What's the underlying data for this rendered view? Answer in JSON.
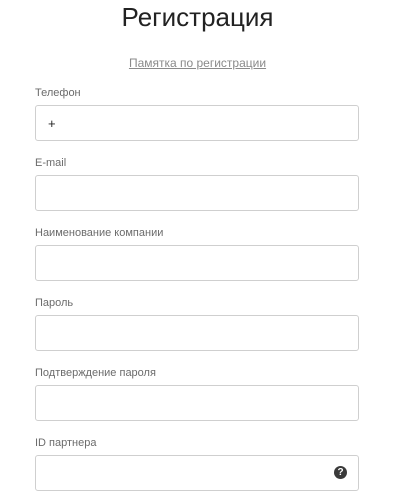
{
  "page": {
    "title": "Регистрация",
    "memo_link": "Памятка по регистрации"
  },
  "fields": {
    "phone": {
      "label": "Телефон",
      "value": "+"
    },
    "email": {
      "label": "E-mail",
      "value": ""
    },
    "company": {
      "label": "Наименование компании",
      "value": ""
    },
    "password": {
      "label": "Пароль",
      "value": ""
    },
    "password_confirm": {
      "label": "Подтверждение пароля",
      "value": ""
    },
    "partner_id": {
      "label": "ID партнера",
      "value": ""
    }
  },
  "icons": {
    "partner_help": {
      "name": "question-circle-icon",
      "glyph": "?"
    }
  }
}
